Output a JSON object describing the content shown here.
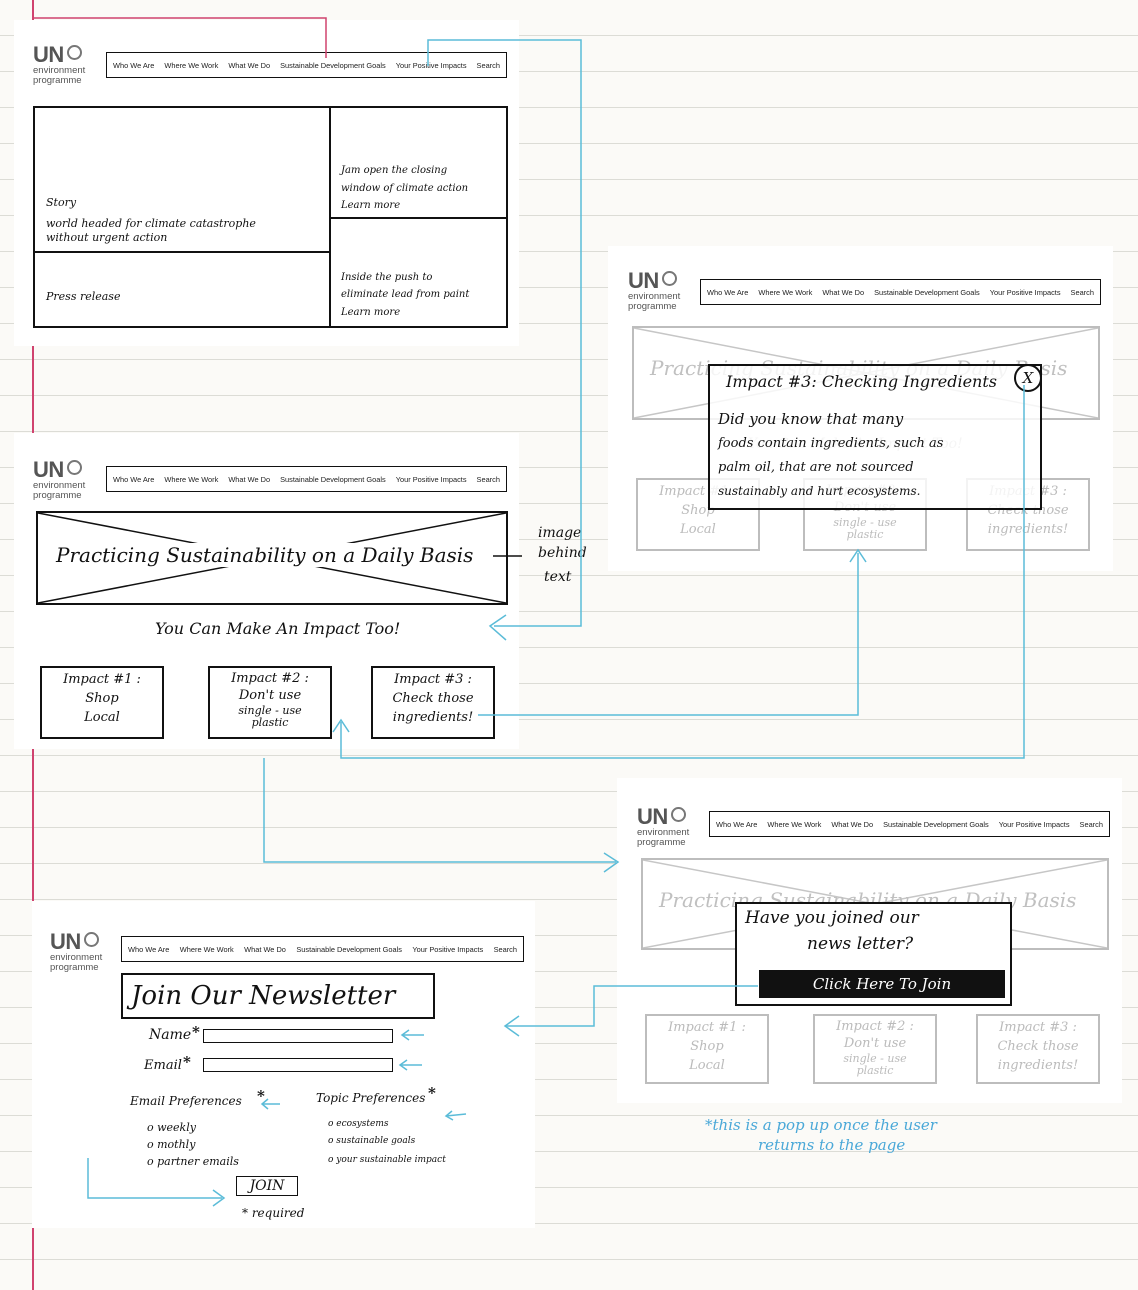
{
  "nav_items": [
    "Who We Are",
    "Where We Work",
    "What We Do",
    "Sustainable Development Goals",
    "Your Positive Impacts",
    "Search"
  ],
  "logo": {
    "un": "UN",
    "line1": "environment",
    "line2": "programme"
  },
  "home": {
    "story_label": "Story",
    "story_text_1": "world headed for climate catastrophe",
    "story_text_2": "without urgent action",
    "press_label": "Press release",
    "side1_line1": "Jam open the closing",
    "side1_line2": "window of climate action",
    "side1_link": "Learn more",
    "side2_line1": "Inside the push to",
    "side2_line2": "eliminate lead from paint",
    "side2_link": "Learn more"
  },
  "impacts_page": {
    "hero_text": "Practicing Sustainability on a Daily Basis",
    "hero_note_1": "image",
    "hero_note_2": "behind",
    "hero_note_3": "text",
    "subtitle": "You Can Make An Impact Too!",
    "impacts": [
      {
        "title": "Impact #1 :",
        "line1": "Shop",
        "line2": "Local"
      },
      {
        "title": "Impact #2 :",
        "line1": "Don't use",
        "line2": "single - use",
        "line3": "plastic"
      },
      {
        "title": "Impact #3 :",
        "line1": "Check those",
        "line2": "ingredients!"
      }
    ]
  },
  "ingredient_popup": {
    "title": "Impact #3: Checking Ingredients",
    "close": "X",
    "line1": "Did you know that many",
    "line2": "foods contain ingredients, such as",
    "line3": "palm oil, that are not sourced",
    "line4": "sustainably and hurt ecosystems."
  },
  "newsletter_popup": {
    "line1": "Have you joined our",
    "line2": "news letter?",
    "button": "Click Here To Join",
    "note_1": "*this is a pop up once the user",
    "note_2": "returns to the page"
  },
  "newsletter_page": {
    "title": "Join Our Newsletter",
    "name_label": "Name",
    "email_label": "Email",
    "required_mark": "*",
    "email_pref_label": "Email Preferences",
    "topic_pref_label": "Topic Preferences",
    "email_prefs": [
      "o weekly",
      "o mothly",
      "o partner emails"
    ],
    "topic_prefs": [
      "o ecosystems",
      "o sustainable goals",
      "o your sustainable impact"
    ],
    "join_button": "JOIN",
    "required_note": "* required"
  },
  "colors": {
    "connector": "#5bbcd8",
    "margin": "#d0436f",
    "ink": "#111111",
    "faded": "#bbbbbb",
    "ruling": "#dcdcd6"
  }
}
